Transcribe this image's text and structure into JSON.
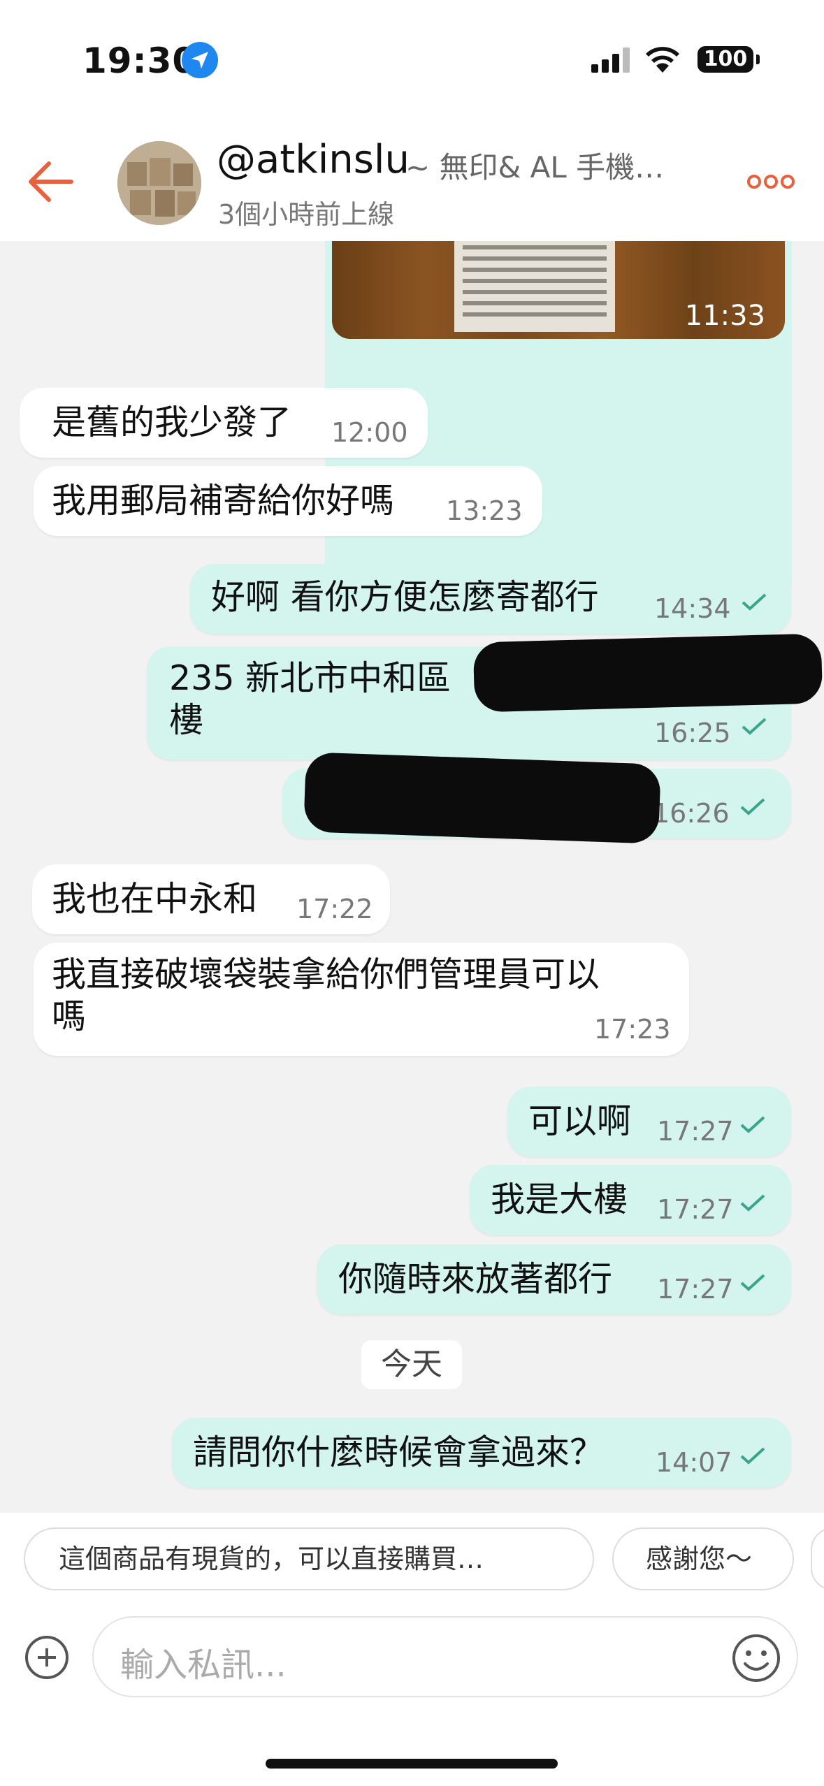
{
  "status_bar": {
    "time": "19:30",
    "battery": "100"
  },
  "header": {
    "username": "@atkinslu",
    "product_snippet": "~ 無印& AL 手機…",
    "last_seen": "3個小時前上線"
  },
  "messages": [
    {
      "dir": "out",
      "type": "image",
      "time": "11:33"
    },
    {
      "dir": "in",
      "text": "是舊的我少發了",
      "time": "12:00"
    },
    {
      "dir": "in",
      "text": "我用郵局補寄給你好嗎",
      "time": "13:23"
    },
    {
      "dir": "out",
      "text": "好啊 看你方便怎麼寄都行",
      "time": "14:34"
    },
    {
      "dir": "out",
      "line1": "235 新北市中和區",
      "line2": "樓",
      "time": "16:25"
    },
    {
      "dir": "out",
      "text": "",
      "time": "16:26"
    },
    {
      "dir": "in",
      "text": "我也在中永和",
      "time": "17:22"
    },
    {
      "dir": "in",
      "line1": "我直接破壞袋裝拿給你們管理員可以",
      "line2": "嗎",
      "time": "17:23"
    },
    {
      "dir": "out",
      "text": "可以啊",
      "time": "17:27"
    },
    {
      "dir": "out",
      "text": "我是大樓",
      "time": "17:27"
    },
    {
      "dir": "out",
      "text": "你隨時來放著都行",
      "time": "17:27"
    },
    {
      "dir": "out",
      "text": "請問你什麼時候會拿過來？",
      "time": "14:07"
    }
  ],
  "date_divider": "今天",
  "quick_replies": [
    "這個商品有現貨的，可以直接購買…",
    "感謝您～"
  ],
  "composer": {
    "placeholder": "輸入私訊..."
  },
  "colors": {
    "accent": "#e8603c",
    "outgoing_bubble": "#d4f5ee",
    "incoming_bubble": "#ffffff",
    "background": "#f2f2f2"
  },
  "icons": [
    "location-arrow-icon",
    "signal-icon",
    "wifi-icon",
    "back-arrow-icon",
    "more-icon",
    "read-check-icon",
    "add-icon",
    "emoji-icon"
  ]
}
